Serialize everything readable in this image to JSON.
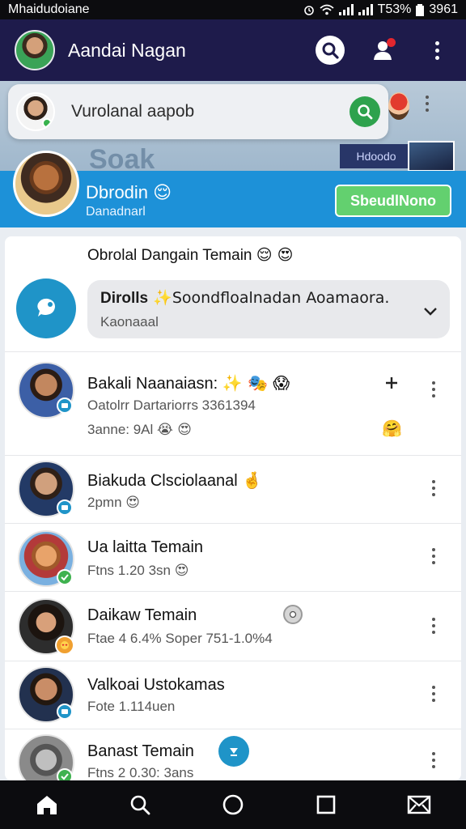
{
  "status_bar": {
    "carrier": "Mhaidudoiane",
    "battery": "T53%",
    "time": "3961"
  },
  "app_bar": {
    "title": "Aandai Nagan"
  },
  "search": {
    "text": "Vurolanal aapob"
  },
  "background": {
    "word": "Soak",
    "mini_card": "Hdoodo"
  },
  "profile": {
    "name": "Dbrodin",
    "name_emoji": "😌",
    "subtitle": "Danadnarl",
    "button": "SbeudlNono"
  },
  "section": {
    "title": "Obrolal Dangain Temain",
    "emojis": "😌 😍"
  },
  "feature": {
    "title_bold": "Dirolls",
    "title_rest": " ✨Soondfloalnadan Aoamaora.",
    "subtitle": "Kaonaaal"
  },
  "rows": [
    {
      "name": "Bakali Naanaiasn:",
      "name_emoji": "✨ 🎭 😱",
      "sub": "Oatolrr Dartariorrs 3361394",
      "line3": "3anne: 9Al",
      "line3_emoji": "😭 😍"
    },
    {
      "name": "Biakuda Clsciolaanal",
      "name_emoji": "🤞",
      "sub": "2pmn",
      "sub_emoji": "😍"
    },
    {
      "name": "Ua laitta Temain",
      "sub": "Ftns 1.20 3sn",
      "sub_emoji": "😍"
    },
    {
      "name": "Daikaw Temain",
      "sub": "Ftae 4 6.4% Soper 751-1.0%4"
    },
    {
      "name": "Valkoai Ustokamas",
      "sub": "Fote 1.114uen"
    },
    {
      "name": "Banast Temain",
      "sub": "Ftns 2 0.30: 3ans"
    }
  ],
  "colors": {
    "app_bar": "#1e1b4b",
    "banner": "#1d91d8",
    "accent_green": "#63d06f",
    "search_green": "#2ea24d",
    "badge_blue": "#1f94c8"
  }
}
